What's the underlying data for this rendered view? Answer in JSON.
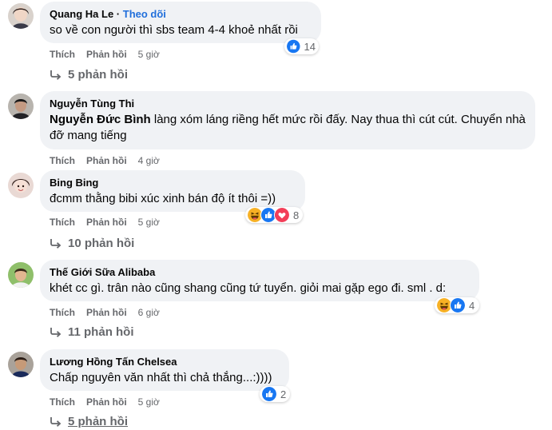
{
  "comments": [
    {
      "author": "Quang Ha Le",
      "follow_sep": " · ",
      "follow": "Theo dõi",
      "text": "so về con người thì sbs team 4-4 khoẻ nhất rồi",
      "like": "Thích",
      "reply": "Phản hồi",
      "time": "5 giờ",
      "reply_count": "5 phản hồi",
      "reaction_count": "14",
      "reactions": [
        "like-icon"
      ]
    },
    {
      "author": "Nguyễn Tùng Thi",
      "mention": "Nguyễn Đức Bình",
      "text": " làng xóm láng riềng hết mức rồi đấy. Nay thua thì cút cút. Chuyển nhà đỡ mang tiếng",
      "like": "Thích",
      "reply": "Phản hồi",
      "time": "4 giờ"
    },
    {
      "author": "Bing Bing",
      "text": "đcmm thằng bibi xúc xinh bán độ ít thôi =))",
      "like": "Thích",
      "reply": "Phản hồi",
      "time": "5 giờ",
      "reply_count": "10 phản hồi",
      "reaction_count": "8",
      "reactions": [
        "haha-icon",
        "like-icon",
        "love-icon"
      ]
    },
    {
      "author": "Thế Giới Sữa Alibaba",
      "text": "khét cc gì. trân nào cũng shang cũng tứ tuyển. giỏi mai gặp ego đi. sml . d:",
      "like": "Thích",
      "reply": "Phản hồi",
      "time": "6 giờ",
      "reply_count": "11 phản hồi",
      "reaction_count": "4",
      "reactions": [
        "haha-icon",
        "like-icon"
      ]
    },
    {
      "author": "Lương Hồng Tấn Chelsea",
      "text": "Chấp nguyên văn nhất thì chả thắng...:))))",
      "like": "Thích",
      "reply": "Phản hồi",
      "time": "5 giờ",
      "reply_count": "5 phản hồi",
      "reaction_count": "2",
      "reactions": [
        "like-icon"
      ]
    }
  ],
  "colors": {
    "bubble": "#f0f2f5",
    "link": "#216fdb",
    "meta": "#65676b",
    "like": "#1877f2",
    "love": "#f33e58",
    "haha": "#f7b125"
  }
}
